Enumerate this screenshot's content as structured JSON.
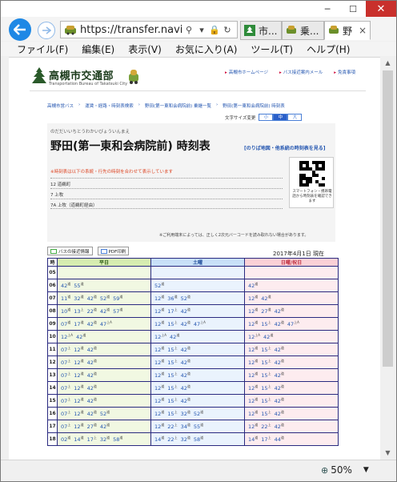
{
  "browser": {
    "url": "https://transfer.naviti...",
    "tabs": [
      {
        "label": "市..."
      },
      {
        "label": "乗..."
      },
      {
        "label": "野"
      }
    ],
    "close_tab_glyph": "×",
    "menu": [
      "ファイル(F)",
      "編集(E)",
      "表示(V)",
      "お気に入り(A)",
      "ツール(T)",
      "ヘルプ(H)"
    ],
    "zoom": "50%"
  },
  "site": {
    "name": "高槻市交通部",
    "name_en": "Transportation Bureau of Takatsuki City",
    "header_links": [
      "高槻市ホームページ",
      "バス接近案内メール",
      "免責事項"
    ]
  },
  "breadcrumb": [
    "高槻市営バス",
    "運賃・経路・時刻表検索",
    "野田(第一東和会病院前) 乗継一覧",
    "野田(第一東和会病院前) 時刻表"
  ],
  "font_size": {
    "label": "文字サイズ変更",
    "options": [
      "小",
      "中",
      "大"
    ],
    "selected": "中"
  },
  "stop": {
    "kana": "のだだいいちとうわかいびょういんまえ",
    "name": "野田(第一東和会病院前) 時刻表",
    "route_map_link": "[のりば地図・他系統の時刻表を見る]",
    "notice": "※時刻表は以下の系統・行先の時刻を合わせて表示しています",
    "lines": [
      "12 道鵜町",
      "7 上牧",
      "7A 上牧（道鵜町経由）"
    ]
  },
  "qr": {
    "caption": "スマートフォン・携帯電話から時刻表を確認できます",
    "note": "※ご利用端末によっては、正しく2次元バーコードを読み取れない場合があります。"
  },
  "tools": {
    "bus_info": "バスの接近情報",
    "pdf": "PDF印刷"
  },
  "as_of": "2017年4月1日 現在",
  "timetable": {
    "headers": {
      "hour": "時",
      "weekday": "平日",
      "saturday": "土曜",
      "holiday": "日曜/祝日"
    },
    "rows": [
      {
        "hour": "05",
        "weekday": [],
        "saturday": [],
        "holiday": []
      },
      {
        "hour": "06",
        "weekday": [
          [
            "42",
            "道"
          ],
          [
            "55",
            "道"
          ]
        ],
        "saturday": [
          [
            "52",
            "道"
          ]
        ],
        "holiday": [
          [
            "42",
            "道"
          ]
        ]
      },
      {
        "hour": "07",
        "weekday": [
          [
            "11",
            "道"
          ],
          [
            "32",
            "道"
          ],
          [
            "42",
            "道"
          ],
          [
            "52",
            "道"
          ],
          [
            "59",
            "道"
          ]
        ],
        "saturday": [
          [
            "12",
            "道"
          ],
          [
            "36",
            "道"
          ],
          [
            "52",
            "道"
          ]
        ],
        "holiday": [
          [
            "12",
            "道"
          ],
          [
            "42",
            "道"
          ]
        ]
      },
      {
        "hour": "08",
        "weekday": [
          [
            "10",
            "道"
          ],
          [
            "13",
            "上"
          ],
          [
            "22",
            "道"
          ],
          [
            "42",
            "道"
          ],
          [
            "57",
            "道"
          ]
        ],
        "saturday": [
          [
            "12",
            "道"
          ],
          [
            "17",
            "上"
          ],
          [
            "42",
            "道"
          ]
        ],
        "holiday": [
          [
            "12",
            "道"
          ],
          [
            "27",
            "道"
          ],
          [
            "42",
            "道"
          ]
        ]
      },
      {
        "hour": "09",
        "weekday": [
          [
            "07",
            "道"
          ],
          [
            "17",
            "道"
          ],
          [
            "42",
            "道"
          ],
          [
            "47",
            "上A"
          ]
        ],
        "saturday": [
          [
            "12",
            "道"
          ],
          [
            "15",
            "上"
          ],
          [
            "42",
            "道"
          ],
          [
            "47",
            "上A"
          ]
        ],
        "holiday": [
          [
            "12",
            "道"
          ],
          [
            "15",
            "上"
          ],
          [
            "42",
            "道"
          ],
          [
            "47",
            "上A"
          ]
        ]
      },
      {
        "hour": "10",
        "weekday": [
          [
            "12",
            "上A"
          ],
          [
            "42",
            "道"
          ]
        ],
        "saturday": [
          [
            "12",
            "上A"
          ],
          [
            "42",
            "道"
          ]
        ],
        "holiday": [
          [
            "12",
            "上A"
          ],
          [
            "42",
            "道"
          ]
        ]
      },
      {
        "hour": "11",
        "weekday": [
          [
            "07",
            "上"
          ],
          [
            "12",
            "道"
          ],
          [
            "42",
            "道"
          ]
        ],
        "saturday": [
          [
            "12",
            "道"
          ],
          [
            "15",
            "上"
          ],
          [
            "42",
            "道"
          ]
        ],
        "holiday": [
          [
            "12",
            "道"
          ],
          [
            "15",
            "上"
          ],
          [
            "42",
            "道"
          ]
        ]
      },
      {
        "hour": "12",
        "weekday": [
          [
            "07",
            "上"
          ],
          [
            "12",
            "道"
          ],
          [
            "42",
            "道"
          ]
        ],
        "saturday": [
          [
            "12",
            "道"
          ],
          [
            "15",
            "上"
          ],
          [
            "42",
            "道"
          ]
        ],
        "holiday": [
          [
            "12",
            "道"
          ],
          [
            "15",
            "上"
          ],
          [
            "42",
            "道"
          ]
        ]
      },
      {
        "hour": "13",
        "weekday": [
          [
            "07",
            "上"
          ],
          [
            "12",
            "道"
          ],
          [
            "42",
            "道"
          ]
        ],
        "saturday": [
          [
            "12",
            "道"
          ],
          [
            "15",
            "上"
          ],
          [
            "42",
            "道"
          ]
        ],
        "holiday": [
          [
            "12",
            "道"
          ],
          [
            "15",
            "上"
          ],
          [
            "42",
            "道"
          ]
        ]
      },
      {
        "hour": "14",
        "weekday": [
          [
            "07",
            "上"
          ],
          [
            "12",
            "道"
          ],
          [
            "42",
            "道"
          ]
        ],
        "saturday": [
          [
            "12",
            "道"
          ],
          [
            "15",
            "上"
          ],
          [
            "42",
            "道"
          ]
        ],
        "holiday": [
          [
            "12",
            "道"
          ],
          [
            "15",
            "上"
          ],
          [
            "42",
            "道"
          ]
        ]
      },
      {
        "hour": "15",
        "weekday": [
          [
            "07",
            "上"
          ],
          [
            "12",
            "道"
          ],
          [
            "42",
            "道"
          ]
        ],
        "saturday": [
          [
            "12",
            "道"
          ],
          [
            "15",
            "上"
          ],
          [
            "42",
            "道"
          ]
        ],
        "holiday": [
          [
            "12",
            "道"
          ],
          [
            "15",
            "上"
          ],
          [
            "42",
            "道"
          ]
        ]
      },
      {
        "hour": "16",
        "weekday": [
          [
            "07",
            "上"
          ],
          [
            "12",
            "道"
          ],
          [
            "42",
            "道"
          ],
          [
            "52",
            "道"
          ]
        ],
        "saturday": [
          [
            "12",
            "道"
          ],
          [
            "15",
            "上"
          ],
          [
            "32",
            "道"
          ],
          [
            "52",
            "道"
          ]
        ],
        "holiday": [
          [
            "12",
            "道"
          ],
          [
            "15",
            "上"
          ],
          [
            "42",
            "道"
          ]
        ]
      },
      {
        "hour": "17",
        "weekday": [
          [
            "07",
            "上"
          ],
          [
            "12",
            "道"
          ],
          [
            "27",
            "道"
          ],
          [
            "42",
            "道"
          ]
        ],
        "saturday": [
          [
            "12",
            "道"
          ],
          [
            "22",
            "上"
          ],
          [
            "34",
            "道"
          ],
          [
            "55",
            "道"
          ]
        ],
        "holiday": [
          [
            "12",
            "道"
          ],
          [
            "22",
            "上"
          ],
          [
            "42",
            "道"
          ]
        ]
      },
      {
        "hour": "18",
        "weekday": [
          [
            "02",
            "道"
          ],
          [
            "14",
            "道"
          ],
          [
            "17",
            "上"
          ],
          [
            "32",
            "道"
          ],
          [
            "58",
            "道"
          ]
        ],
        "saturday": [
          [
            "14",
            "道"
          ],
          [
            "22",
            "上"
          ],
          [
            "32",
            "道"
          ],
          [
            "58",
            "道"
          ]
        ],
        "holiday": [
          [
            "14",
            "道"
          ],
          [
            "17",
            "上"
          ],
          [
            "44",
            "道"
          ]
        ]
      }
    ]
  },
  "colors": {
    "weekday_header": "#d6ecb0",
    "saturday_header": "#c8e0f8",
    "holiday_header": "#fbd0d6",
    "link": "#2456b0",
    "back_button": "#1e88e5",
    "close_button": "#c9302c"
  }
}
